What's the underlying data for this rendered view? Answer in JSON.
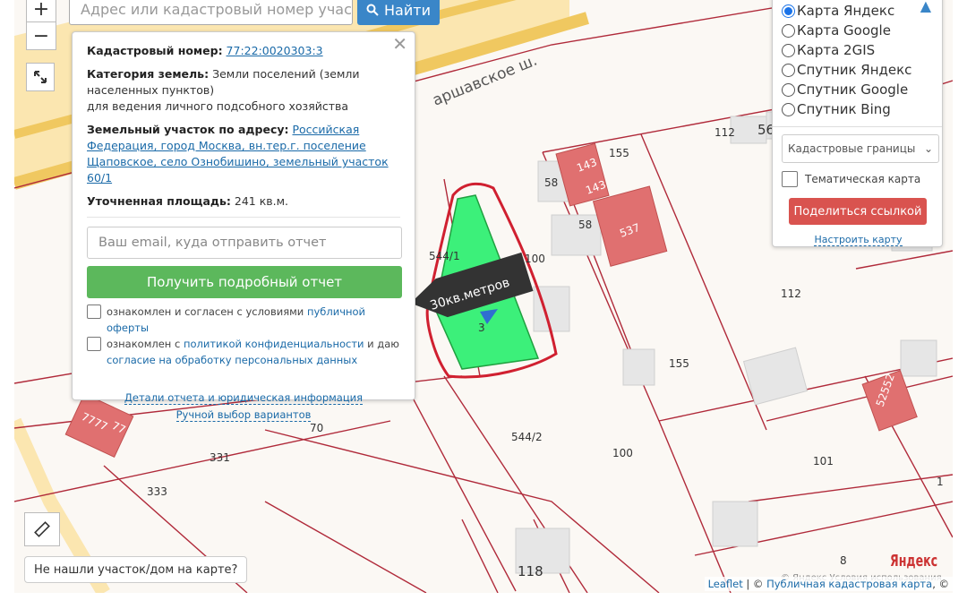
{
  "search": {
    "placeholder": "Адрес или кадастровый номер участка",
    "button_label": "Найти",
    "button_icon": "search-icon"
  },
  "zoom": {
    "in_label": "+",
    "out_label": "−"
  },
  "map_labels": {
    "street": "аршавское ш.",
    "annotation": "30кв.метров",
    "plots": [
      "56",
      "112",
      "143",
      "143",
      "155",
      "58",
      "58",
      "537",
      "544/1",
      "100",
      "3",
      "112",
      "155",
      "544/2",
      "100",
      "101",
      "1",
      "70",
      "331",
      "333",
      "77",
      "7777",
      "52552",
      "118",
      "8"
    ]
  },
  "popup": {
    "cadastral_label": "Кадастровый номер:",
    "cadastral_value": "77:22:0020303:3",
    "category_label": "Категория земель:",
    "category_value": "Земли поселений (земли населенных пунктов)",
    "category_use": "для ведения личного подсобного хозяйства",
    "address_label": "Земельный участок по адресу:",
    "address_value": "Российская Федерация, город Москва, вн.тер.г. поселение Щаповское, село Ознобишино, земельный участок 60/1",
    "area_label": "Уточненная площадь:",
    "area_value": "241 кв.м.",
    "email_placeholder": "Ваш email, куда отправить отчет",
    "report_button": "Получить подробный отчет",
    "agree1_text": "ознакомлен и согласен с условиями",
    "agree1_link": "публичной оферты",
    "agree2_text": "ознакомлен с",
    "agree2_link": "политикой конфиденциальности",
    "agree2_and": "и даю",
    "agree2_link2": "согласие на обработку персональных данных",
    "details_link": "Детали отчета и юридическая информация",
    "manual_link": "Ручной выбор вариантов",
    "close": "✕"
  },
  "layers": {
    "options": [
      {
        "label": "Карта Яндекс",
        "selected": true
      },
      {
        "label": "Карта Google",
        "selected": false
      },
      {
        "label": "Карта 2GIS",
        "selected": false
      },
      {
        "label": "Спутник Яндекс",
        "selected": false
      },
      {
        "label": "Спутник Google",
        "selected": false
      },
      {
        "label": "Спутник Bing",
        "selected": false
      }
    ],
    "overlay_select": "Кадастровые границы",
    "thematic_label": "Тематическая карта",
    "share_button": "Поделиться ссылкой",
    "setup_link": "Настроить карту"
  },
  "not_found": "Не нашли участок/дом на карте?",
  "attribution": {
    "leaflet": "Leaflet",
    "sep": " | © ",
    "pkk": "Публичная кадастровая карта",
    "tail": ", ©"
  },
  "yandex": {
    "logo": "Яндекс",
    "terms": "© Яндекс   Условия использования"
  },
  "colors": {
    "accent": "#3a86c8",
    "report_btn": "#5cb85c",
    "share_btn": "#d9534f",
    "plot_fill": "#3cf07a",
    "building_red": "#e07070",
    "outline_red": "#d02030"
  }
}
